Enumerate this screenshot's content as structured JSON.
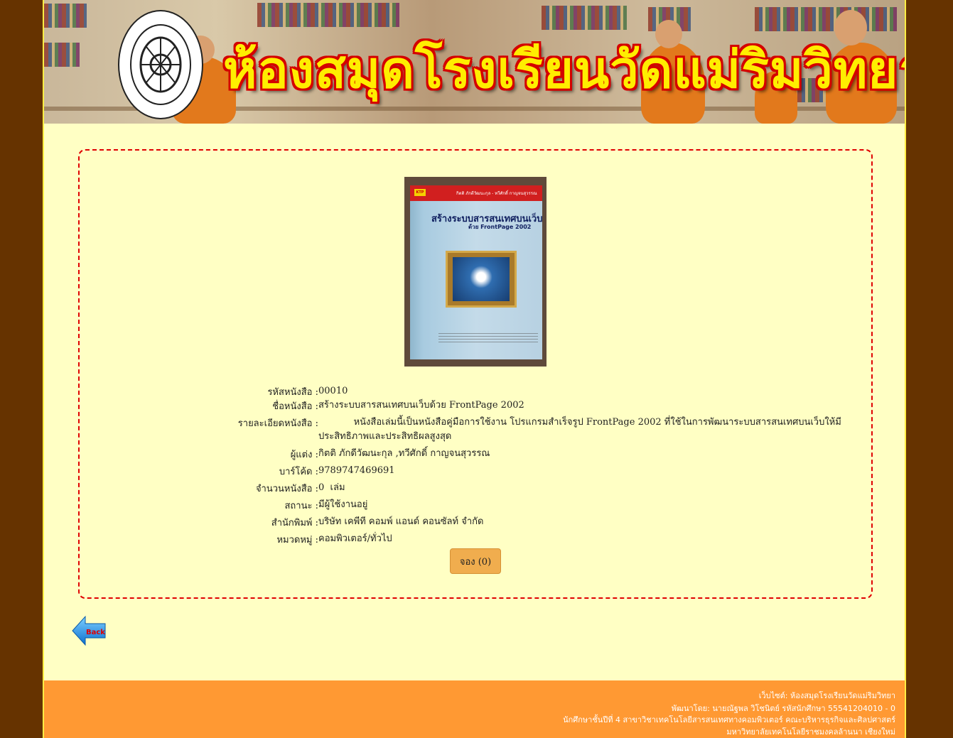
{
  "header": {
    "banner_title": "ห้องสมุดโรงเรียนวัดแม่ริมวิทยา",
    "logo_icon": "school-seal-icon"
  },
  "book": {
    "cover": {
      "publisher_mark": "KTP",
      "authors": "กิตติ ภักดีวัฒนะกุล - ทวีศักดิ์ กาญจนสุวรรณ",
      "title": "สร้างระบบสารสนเทศบนเว็บ",
      "subtitle": "ด้วย FrontPage 2002"
    },
    "fields": [
      {
        "label": "รหัสหนังสือ :",
        "value": "00010"
      },
      {
        "label": "ชื่อหนังสือ :",
        "value": "สร้างระบบสารสนเทศบนเว็บด้วย FrontPage 2002"
      },
      {
        "label": "รายละเอียดหนังสือ :",
        "value": "            หนังสือเล่มนี้เป็นหนังสือคู่มือการใช้งาน โปรแกรมสำเร็จรูป FrontPage 2002 ที่ใช้ในการพัฒนาระบบสารสนเทศบนเว็บให้มีประสิทธิภาพและประสิทธิผลสูงสุด"
      },
      {
        "label": "ผู้แต่ง :",
        "value": "กิตติ ภักดีวัฒนะกุล ,ทวีศักดิ์ กาญจนสุวรรณ"
      },
      {
        "label": "บาร์โค้ด :",
        "value": "9789747469691"
      },
      {
        "label": "จำนวนหนังสือ :",
        "value": "0  เล่ม"
      },
      {
        "label": "สถานะ :",
        "value": "มีผู้ใช้งานอยู่"
      },
      {
        "label": "สำนักพิมพ์ :",
        "value": "บริษัท เคพีที คอมพ์ แอนด์ คอนซัลท์ จำกัด"
      },
      {
        "label": "หมวดหมู่ :",
        "value": "คอมพิวเตอร์/ทั่วไป"
      }
    ],
    "reserve_label": "จอง (0)"
  },
  "back": {
    "label": "Back",
    "icon": "back-arrow-icon"
  },
  "footer": {
    "line1": "เว็บไซต์: ห้องสมุดโรงเรียนวัดแม่ริมวิทยา",
    "line2": "พัฒนาโดย: นายณัฐพล วิโชนิตย์ รหัสนักศึกษา 55541204010 - 0",
    "line3": "นักศึกษาชั้นปีที่ 4 สาขาวิชาเทคโนโลยีสารสนเทศทางคอมพิวเตอร์ คณะบริหารธุรกิจและศิลปศาสตร์",
    "line4": "มหาวิทยาลัยเทคโนโลยีราชมงคลล้านนา เชียงใหม่"
  },
  "colors": {
    "background": "#663300",
    "page": "#ffffc4",
    "dashed_border": "#e00000",
    "button": "#f0ad4e",
    "footer": "#ff9933",
    "banner_title": "#ffee00"
  }
}
